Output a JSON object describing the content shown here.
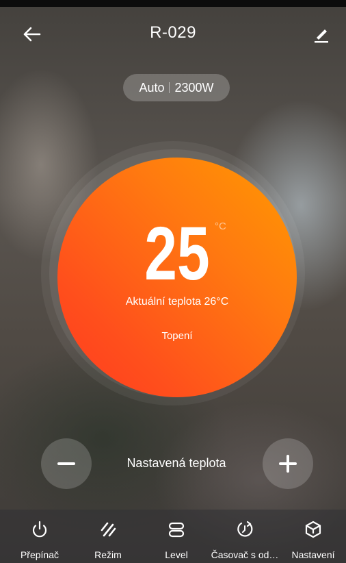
{
  "header": {
    "title": "R-029",
    "back_icon": "arrow-left-icon",
    "edit_icon": "pencil-icon"
  },
  "status_pill": {
    "mode": "Auto",
    "power": "2300W"
  },
  "dial": {
    "set_temperature": "25",
    "unit": "°C",
    "current_temperature_text": "Aktuální teplota 26°C",
    "operating_state": "Topení",
    "gradient_colors": [
      "#ff9a00",
      "#ff3a20"
    ]
  },
  "controls": {
    "decrease_icon": "minus-icon",
    "increase_icon": "plus-icon",
    "label": "Nastavená teplota"
  },
  "tabs": [
    {
      "label": "Přepínač",
      "icon": "power-icon"
    },
    {
      "label": "Režim",
      "icon": "mode-slashes-icon"
    },
    {
      "label": "Level",
      "icon": "level-icon"
    },
    {
      "label": "Časovač s od…",
      "icon": "timer-icon"
    },
    {
      "label": "Nastavení",
      "icon": "cube-settings-icon"
    }
  ]
}
